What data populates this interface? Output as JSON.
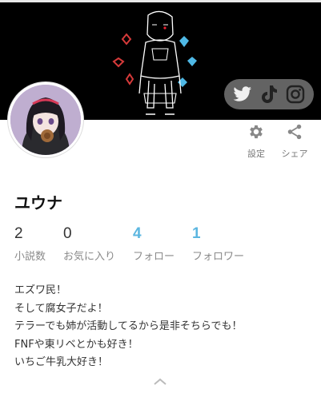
{
  "profile": {
    "name": "ユウナ"
  },
  "actions": {
    "settings_label": "設定",
    "share_label": "シェア"
  },
  "social": [
    "twitter-icon",
    "tiktok-icon",
    "instagram-icon"
  ],
  "stats": [
    {
      "value": "2",
      "label": "小説数"
    },
    {
      "value": "0",
      "label": "お気に入り"
    },
    {
      "value": "4",
      "label": "フォロー"
    },
    {
      "value": "1",
      "label": "フォロワー"
    }
  ],
  "bio": [
    "エズワ民！",
    "そして腐女子だよ！",
    "テラーでも姉が活動してるから是非そちらでも！",
    "FNFや東リベとかも好き！",
    "いちご牛乳大好き！"
  ],
  "colors": {
    "accent": "#5bb6e0",
    "banner_bg": "#000000"
  }
}
